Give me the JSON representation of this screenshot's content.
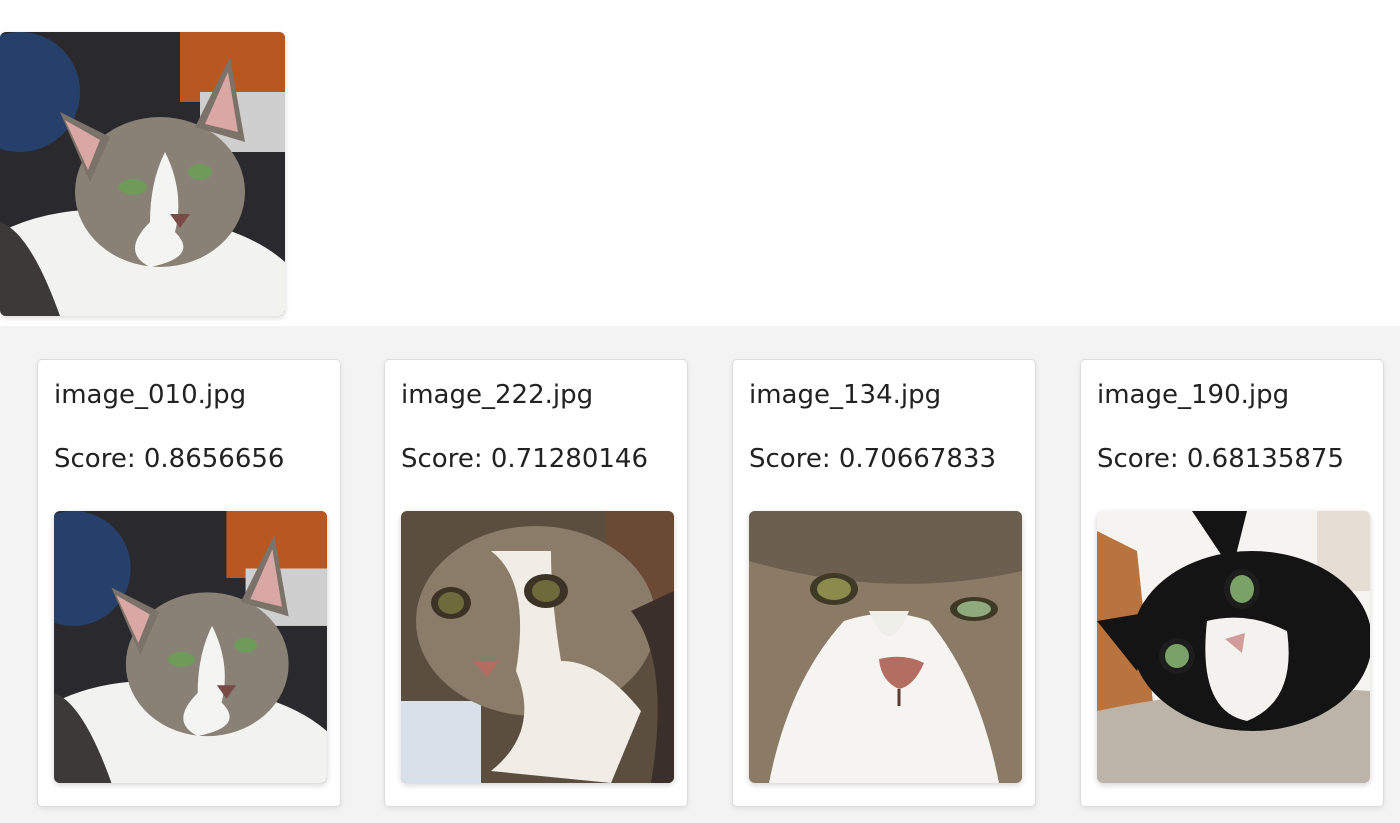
{
  "query": {
    "image_subject": "tabby and white cat"
  },
  "results": [
    {
      "filename": "image_010.jpg",
      "score_label": "Score: 0.8656656",
      "image_subject": "tabby and white cat"
    },
    {
      "filename": "image_222.jpg",
      "score_label": "Score: 0.71280146",
      "image_subject": "tabby and white cat close-up"
    },
    {
      "filename": "image_134.jpg",
      "score_label": "Score: 0.70667833",
      "image_subject": "tabby and white cat frowning close-up"
    },
    {
      "filename": "image_190.jpg",
      "score_label": "Score: 0.68135875",
      "image_subject": "black and white tuxedo cat"
    }
  ]
}
